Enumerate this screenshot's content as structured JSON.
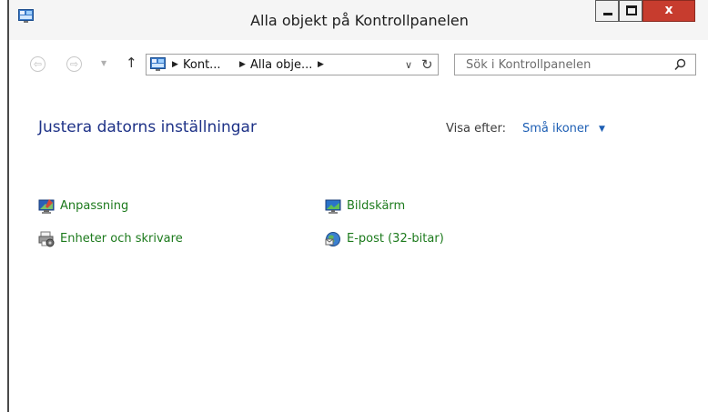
{
  "window": {
    "title": "Alla objekt på Kontrollpanelen",
    "buttons": {
      "minimize": "minimize",
      "maximize": "maximize",
      "close": "x"
    }
  },
  "navigation": {
    "breadcrumbs": [
      "Kont...",
      "Alla obje..."
    ],
    "search_placeholder": "Sök i Kontrollpanelen"
  },
  "main": {
    "heading": "Justera datorns inställningar",
    "view_by_label": "Visa efter:",
    "view_by_value": "Små ikoner",
    "items": [
      {
        "label": "Anpassning",
        "icon": "personalization-icon"
      },
      {
        "label": "Bildskärm",
        "icon": "display-icon"
      },
      {
        "label": "Enheter och skrivare",
        "icon": "devices-printers-icon"
      },
      {
        "label": "E-post (32-bitar)",
        "icon": "mail-icon"
      }
    ]
  },
  "colors": {
    "heading": "#1e3287",
    "link_green": "#1c7a1c",
    "link_blue": "#1e5fb4",
    "close_button": "#c73c2e"
  }
}
